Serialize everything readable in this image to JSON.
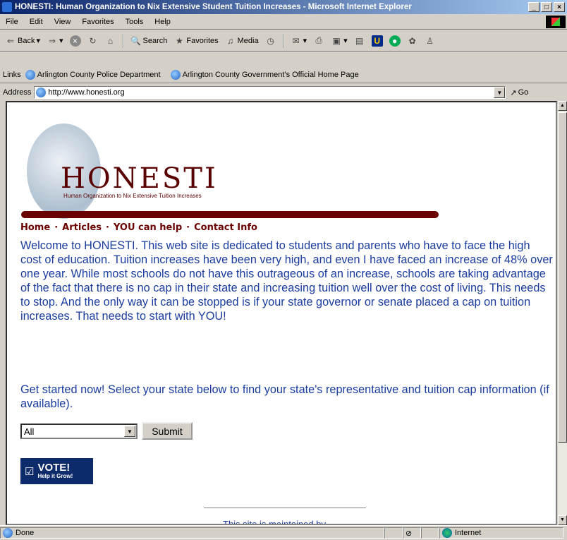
{
  "window": {
    "title": "HONESTI: Human Organization to Nix Extensive Student Tuition Increases - Microsoft Internet Explorer"
  },
  "menu": [
    "File",
    "Edit",
    "View",
    "Favorites",
    "Tools",
    "Help"
  ],
  "toolbar": {
    "back": "Back",
    "search": "Search",
    "favorites": "Favorites",
    "media": "Media"
  },
  "links": {
    "label": "Links",
    "items": [
      "Arlington County Police Department",
      "Arlington County Government's Official Home Page"
    ]
  },
  "address": {
    "label": "Address",
    "url": "http://www.honesti.org",
    "go": "Go"
  },
  "page": {
    "logo_title": "HONESTI",
    "logo_subtitle": "Human Organization to Nix Extensive Tuition Increases",
    "nav": [
      "Home",
      "Articles",
      "YOU can help",
      "Contact Info"
    ],
    "nav_separator": "·",
    "welcome": "Welcome to HONESTI. This web site is dedicated to students and parents who have to face the high cost of education. Tuition increases have been very high, and even I have faced an increase of 48% over one year. While most schools do not have this outrageous of an increase, schools are taking advantage of the fact that there is no cap in their state and increasing tuition well over the cost of living. This needs to stop. And the only way it can be stopped is if your state governor or senate placed a cap on tuition increases. That needs to start with YOU!",
    "get_started": "Get started now! Select your state below to find your state's representative and tuition cap information (if available).",
    "state_select": "All",
    "submit": "Submit",
    "vote_title": "VOTE!",
    "vote_sub": "Help it Grow!",
    "maintained": "This site is maintained by"
  },
  "status": {
    "left": "Done",
    "zone": "Internet"
  },
  "colors": {
    "text_blue": "#1a3c9e",
    "brand_red": "#6b0000",
    "vote_bg": "#0d2a6b"
  }
}
